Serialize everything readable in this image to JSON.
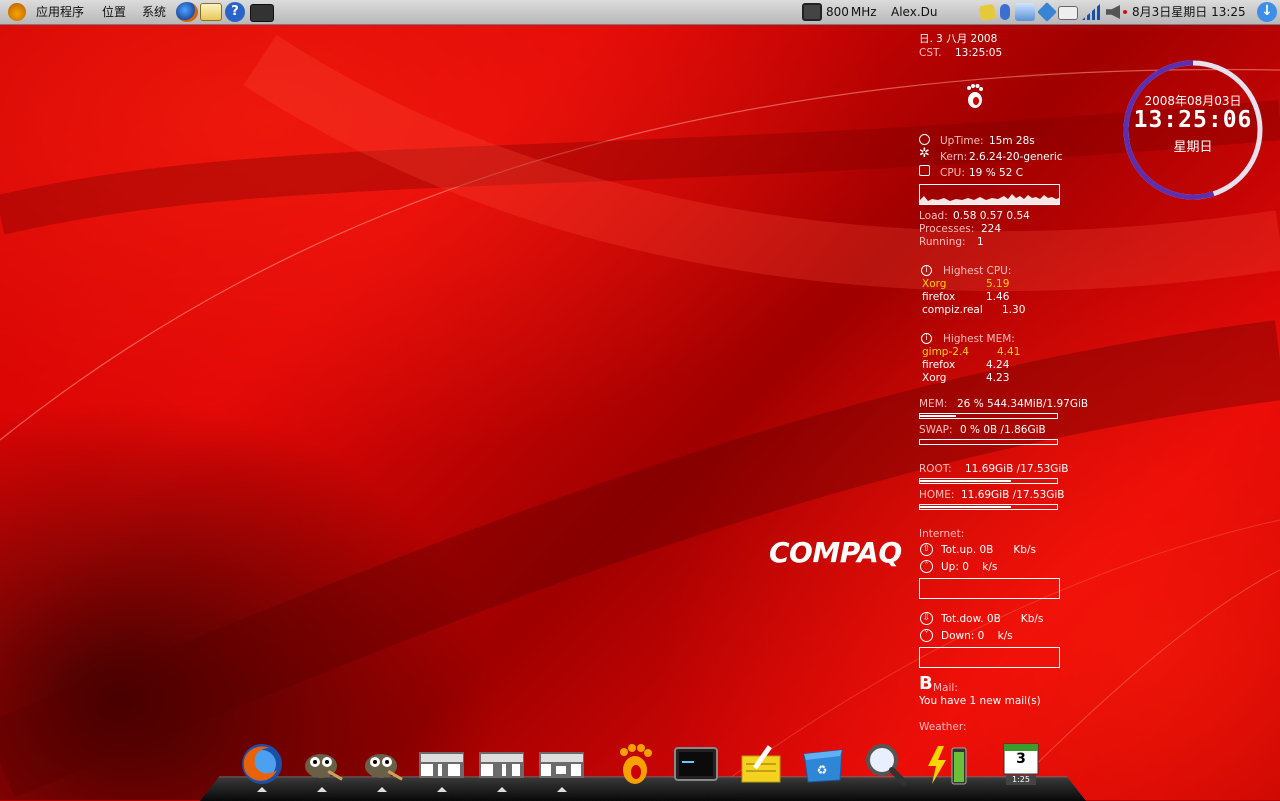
{
  "top_panel": {
    "menus": [
      "应用程序",
      "位置",
      "系统"
    ],
    "cpu_freq": "800",
    "cpu_freq_unit": "MHz",
    "username": "Alex.Du",
    "datetime": "8月3日星期日 13:25"
  },
  "conky": {
    "date_line": "\u0000. 3 \u0000\u0000 2008",
    "date_line_clean": "日. 3 八月 2008",
    "tz_label": "CST.",
    "time": "13:25:05",
    "uptime_label": "UpTime:",
    "uptime": "15m 28s",
    "kern_label": "Kern:",
    "kern": "2.6.24-20-generic",
    "cpu_label": "CPU:",
    "cpu": "19 % 52  C",
    "load_label": "Load:",
    "load": "0.58 0.57 0.54",
    "processes_label": "Processes:",
    "processes": "224",
    "running_label": "Running:",
    "running": "1",
    "highest_cpu_label": "Highest CPU:",
    "top_cpu": [
      {
        "name": "Xorg",
        "value": "5.19"
      },
      {
        "name": "firefox",
        "value": "1.46"
      },
      {
        "name": "compiz.real",
        "value": "1.30"
      }
    ],
    "highest_mem_label": "Highest MEM:",
    "top_mem": [
      {
        "name": "gimp-2.4",
        "value": "4.41"
      },
      {
        "name": "firefox",
        "value": "4.24"
      },
      {
        "name": "Xorg",
        "value": "4.23"
      }
    ],
    "mem_label": "MEM:",
    "mem": "26 % 544.34MiB/1.97GiB",
    "mem_fraction": 0.26,
    "swap_label": "SWAP:",
    "swap": "0  % 0B      /1.86GiB",
    "swap_fraction": 0.0,
    "root_label": "ROOT:",
    "root": "11.69GiB /17.53GiB",
    "root_fraction": 0.667,
    "home_label": "HOME:",
    "home": "11.69GiB /17.53GiB",
    "home_fraction": 0.667,
    "internet_label": "Internet:",
    "totup": "Tot.up. 0B      Kb/s",
    "up": "Up: 0    k/s",
    "totdown": "Tot.dow. 0B      Kb/s",
    "down": "Down: 0    k/s",
    "mail_letter": "B",
    "mail_label": "Mail:",
    "mail_text": "You have 1 new mail(s)",
    "weather_label": "Weather:"
  },
  "clock": {
    "date": "2008年08月03日",
    "time": "13:25:06",
    "weekday": "星期日",
    "ring_fraction": 0.55
  },
  "brand": "COMPAQ",
  "dock": {
    "items": [
      "firefox-icon",
      "gimp-icon",
      "gimp-icon",
      "window-thumb-icon",
      "window-thumb-icon",
      "window-thumb-icon",
      "gnome-foot-icon",
      "terminal-icon",
      "notes-icon",
      "trash-icon",
      "search-icon",
      "battery-icon",
      "calendar-icon"
    ],
    "calendar_day": "3",
    "calendar_time": "1:25"
  },
  "colors": {
    "highlight": "#ffd100",
    "label": "#ffbcbc",
    "clock_ring": "#5b2fb0"
  }
}
